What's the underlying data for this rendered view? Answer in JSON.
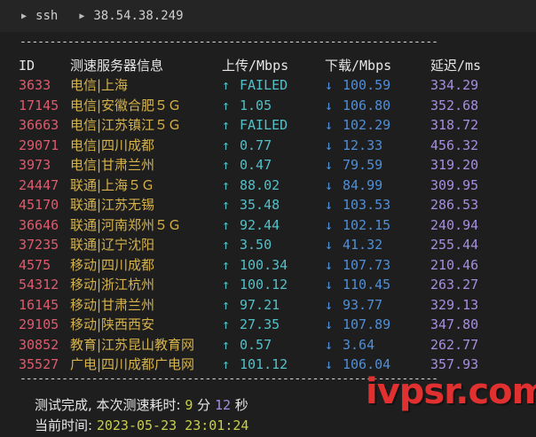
{
  "titlebar": {
    "crumb1": "ssh",
    "crumb2": "38.54.38.249"
  },
  "separator": "----------------------------------------------------------------------",
  "header": {
    "id": "ID",
    "server": "测速服务器信息",
    "upload": "上传/Mbps",
    "download": "下载/Mbps",
    "latency": "延迟/ms"
  },
  "rows": [
    {
      "id": "3633",
      "server": "电信|上海",
      "up": "FAILED",
      "down": "100.59",
      "lat": "334.29"
    },
    {
      "id": "17145",
      "server": "电信|安徽合肥５Ｇ",
      "up": "1.05",
      "down": "106.80",
      "lat": "352.68"
    },
    {
      "id": "36663",
      "server": "电信|江苏镇江５Ｇ",
      "up": "FAILED",
      "down": "102.29",
      "lat": "318.72"
    },
    {
      "id": "29071",
      "server": "电信|四川成都",
      "up": "0.77",
      "down": "12.33",
      "lat": "456.32"
    },
    {
      "id": "3973",
      "server": "电信|甘肃兰州",
      "up": "0.47",
      "down": "79.59",
      "lat": "319.20"
    },
    {
      "id": "24447",
      "server": "联通|上海５Ｇ",
      "up": "88.02",
      "down": "84.99",
      "lat": "309.95"
    },
    {
      "id": "45170",
      "server": "联通|江苏无锡",
      "up": "35.48",
      "down": "103.53",
      "lat": "286.53"
    },
    {
      "id": "36646",
      "server": "联通|河南郑州５Ｇ",
      "up": "92.44",
      "down": "102.15",
      "lat": "240.94"
    },
    {
      "id": "37235",
      "server": "联通|辽宁沈阳",
      "up": "3.50",
      "down": "41.32",
      "lat": "255.44"
    },
    {
      "id": "4575",
      "server": "移动|四川成都",
      "up": "100.34",
      "down": "107.73",
      "lat": "210.46"
    },
    {
      "id": "54312",
      "server": "移动|浙江杭州",
      "up": "100.12",
      "down": "110.45",
      "lat": "263.27"
    },
    {
      "id": "16145",
      "server": "移动|甘肃兰州",
      "up": "97.21",
      "down": "93.77",
      "lat": "329.13"
    },
    {
      "id": "29105",
      "server": "移动|陕西西安",
      "up": "27.35",
      "down": "107.89",
      "lat": "347.80"
    },
    {
      "id": "30852",
      "server": "教育|江苏昆山教育网",
      "up": "0.57",
      "down": "3.64",
      "lat": "262.77"
    },
    {
      "id": "35527",
      "server": "广电|四川成都广电网",
      "up": "101.12",
      "down": "106.04",
      "lat": "357.93"
    }
  ],
  "arrows": {
    "up": "↑",
    "down": "↓"
  },
  "summary": {
    "prefix": "测试完成, 本次测速耗时: ",
    "minutes": "9",
    "min_unit": " 分 ",
    "seconds": "12",
    "sec_unit": " 秒",
    "time_label": "当前时间: ",
    "time_value": "2023-05-23 23:01:24"
  },
  "watermark": "ivpsr.com",
  "colors": {
    "id": "#e05a6e",
    "server": "#d6b34a",
    "upload": "#54c0c8",
    "download": "#4f8fd8",
    "latency": "#a68ee0",
    "watermark": "#e03030"
  }
}
